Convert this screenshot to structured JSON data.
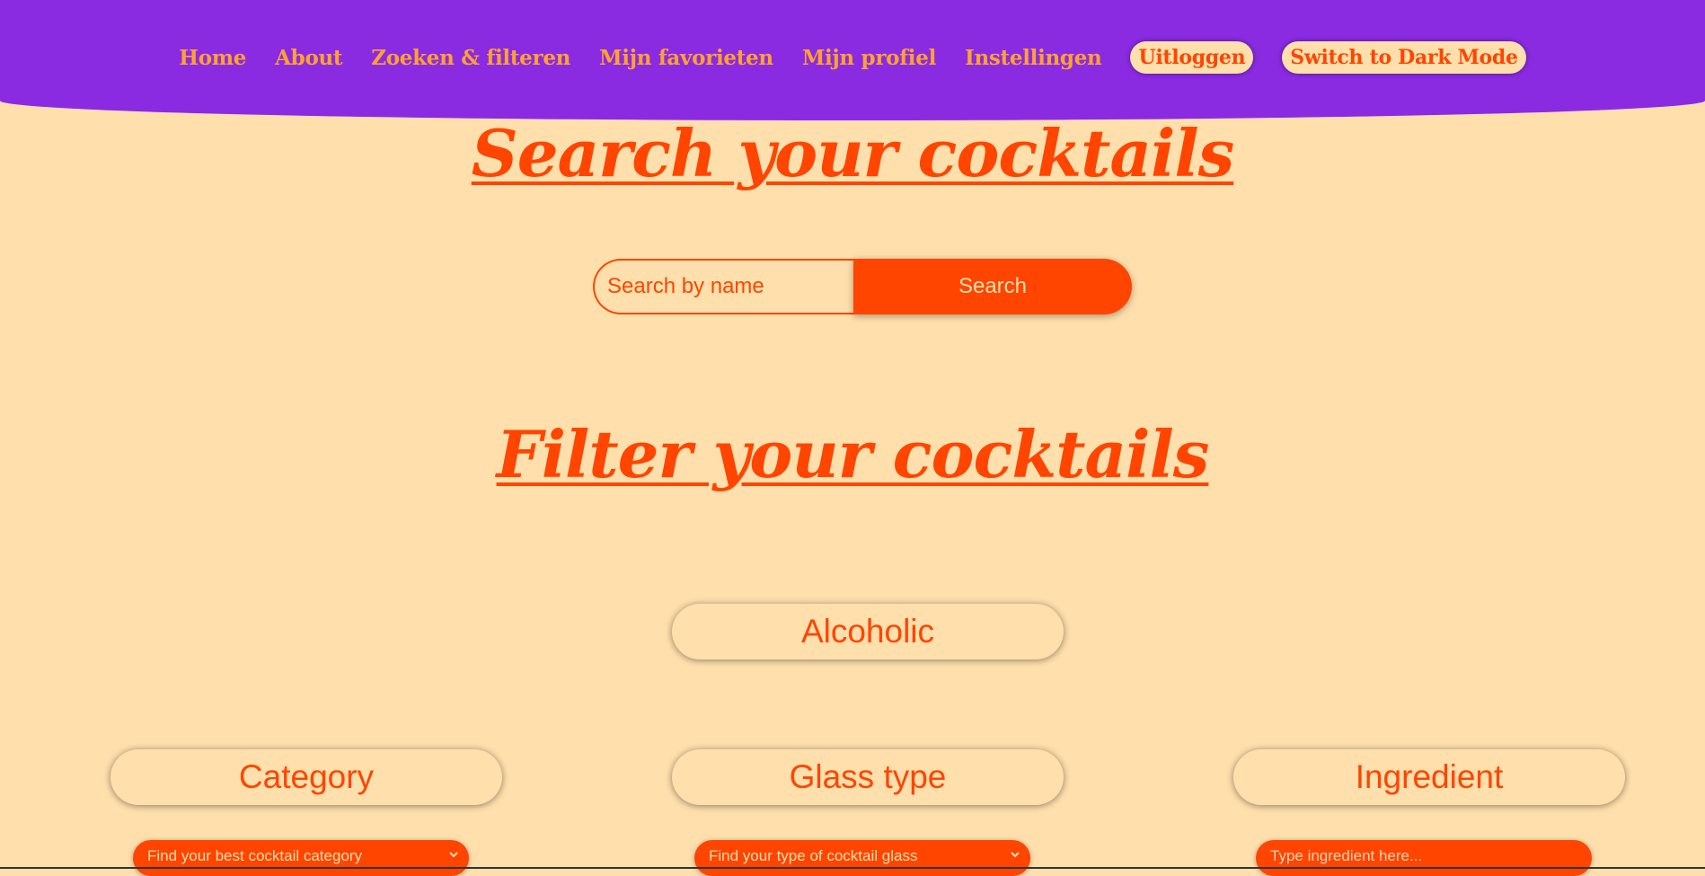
{
  "nav": {
    "links": [
      "Home",
      "About",
      "Zoeken & filteren",
      "Mijn favorieten",
      "Mijn profiel",
      "Instellingen"
    ],
    "logout_label": "Uitloggen",
    "dark_mode_label": "Switch to Dark Mode"
  },
  "search": {
    "title": "Search your cocktails",
    "placeholder": "Search by name",
    "button_label": "Search"
  },
  "filter": {
    "title": "Filter your cocktails",
    "alcoholic_label": "Alcoholic",
    "category_label": "Category",
    "glass_label": "Glass type",
    "ingredient_label": "Ingredient",
    "category_select": "Find your best cocktail category",
    "glass_select": "Find your type of cocktail glass",
    "ingredient_placeholder": "Type ingredient here..."
  },
  "colors": {
    "background": "#ffdfac",
    "navbar": "#8a2be2",
    "accent": "#ff4500",
    "nav_link": "#ffa130"
  },
  "icons": {
    "select_chevron": "chevron-down-icon"
  }
}
